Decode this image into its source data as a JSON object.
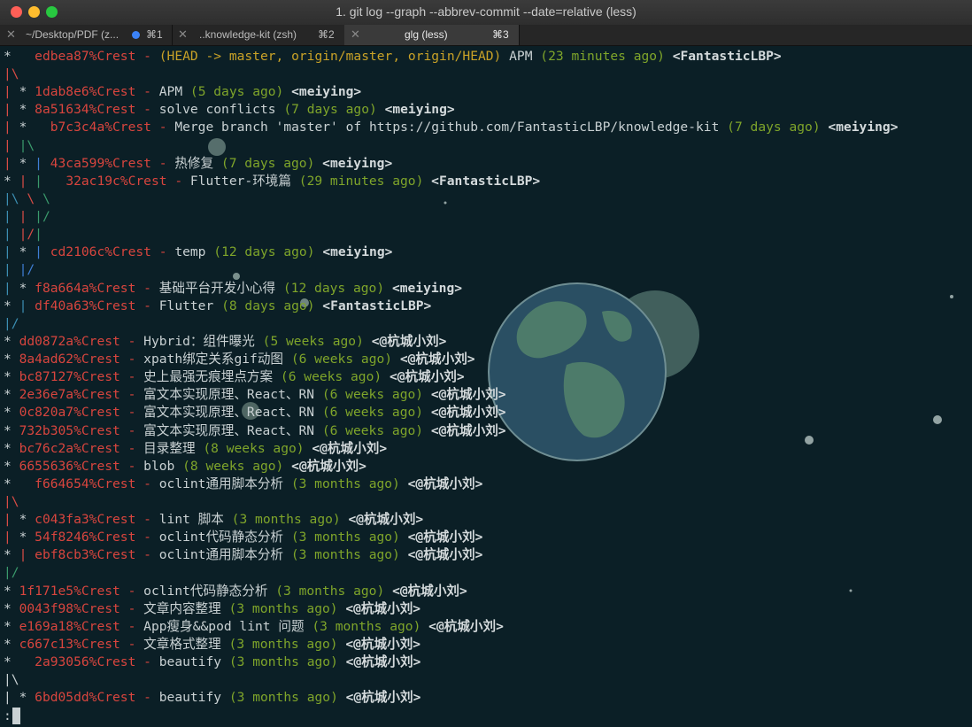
{
  "window": {
    "title": "1. git log --graph  --abbrev-commit --date=relative (less)"
  },
  "tabs": [
    {
      "label": "~/Desktop/PDF (z...",
      "shortcut": "⌘1"
    },
    {
      "label": "..knowledge-kit (zsh)",
      "shortcut": "⌘2"
    },
    {
      "label": "glg (less)",
      "shortcut": "⌘3"
    }
  ],
  "colors": {
    "background": "#0b1f26",
    "hash": "#d8453e",
    "date": "#7fa52a",
    "refs": "#c9a227",
    "graph_red": "#d94c45",
    "graph_green": "#3a9a6c",
    "graph_blue": "#3f7fd6",
    "planet_ocean": "#2a4f63",
    "planet_land": "#4d7b6a"
  },
  "log": [
    {
      "graph": [
        [
          "*   ",
          "white"
        ]
      ],
      "hash": "edbea87%Crest",
      "refs": "(HEAD -> master, origin/master, origin/HEAD)",
      "subject": "APM",
      "date": "(23 minutes ago)",
      "author": "<FantasticLBP>"
    },
    {
      "graph": [
        [
          "|\\",
          "red"
        ]
      ]
    },
    {
      "graph": [
        [
          "| ",
          "red"
        ],
        [
          "* ",
          "white"
        ]
      ],
      "hash": "1dab8e6%Crest",
      "subject": "APM",
      "date": "(5 days ago)",
      "author": "<meiying>"
    },
    {
      "graph": [
        [
          "| ",
          "red"
        ],
        [
          "* ",
          "white"
        ]
      ],
      "hash": "8a51634%Crest",
      "subject": "solve conflicts",
      "date": "(7 days ago)",
      "author": "<meiying>"
    },
    {
      "graph": [
        [
          "| ",
          "red"
        ],
        [
          "*   ",
          "white"
        ]
      ],
      "hash": "b7c3c4a%Crest",
      "subject": "Merge branch 'master' of https://github.com/FantasticLBP/knowledge-kit",
      "date": "(7 days ago)",
      "author": "<meiying>"
    },
    {
      "graph": [
        [
          "| ",
          "red"
        ],
        [
          "|\\",
          "green"
        ]
      ]
    },
    {
      "graph": [
        [
          "| ",
          "red"
        ],
        [
          "* ",
          "white"
        ],
        [
          "| ",
          "blue"
        ]
      ],
      "hash": "43ca599%Crest",
      "subject": "热修复",
      "date": "(7 days ago)",
      "author": "<meiying>"
    },
    {
      "graph": [
        [
          "* ",
          "white"
        ],
        [
          "| ",
          "red"
        ],
        [
          "|   ",
          "green"
        ]
      ],
      "hash": "32ac19c%Crest",
      "subject": "Flutter-环境篇",
      "date": "(29 minutes ago)",
      "author": "<FantasticLBP>"
    },
    {
      "graph": [
        [
          "|\\ ",
          "cyan"
        ],
        [
          "\\ ",
          "red"
        ],
        [
          "\\",
          "green"
        ]
      ]
    },
    {
      "graph": [
        [
          "| ",
          "cyan"
        ],
        [
          "| ",
          "red"
        ],
        [
          "|/",
          "green"
        ]
      ]
    },
    {
      "graph": [
        [
          "| ",
          "cyan"
        ],
        [
          "|/",
          "red"
        ],
        [
          "|",
          "green"
        ]
      ]
    },
    {
      "graph": [
        [
          "| ",
          "cyan"
        ],
        [
          "* ",
          "white"
        ],
        [
          "| ",
          "blue"
        ]
      ],
      "hash": "cd2106c%Crest",
      "subject": "temp",
      "date": "(12 days ago)",
      "author": "<meiying>"
    },
    {
      "graph": [
        [
          "| ",
          "cyan"
        ],
        [
          "|/",
          "blue"
        ]
      ]
    },
    {
      "graph": [
        [
          "| ",
          "cyan"
        ],
        [
          "* ",
          "white"
        ]
      ],
      "hash": "f8a664a%Crest",
      "subject": "基础平台开发小心得",
      "date": "(12 days ago)",
      "author": "<meiying>"
    },
    {
      "graph": [
        [
          "* ",
          "white"
        ],
        [
          "| ",
          "cyan"
        ]
      ],
      "hash": "df40a63%Crest",
      "subject": "Flutter",
      "date": "(8 days ago)",
      "author": "<FantasticLBP>"
    },
    {
      "graph": [
        [
          "|/",
          "cyan"
        ]
      ]
    },
    {
      "graph": [
        [
          "* ",
          "white"
        ]
      ],
      "hash": "dd0872a%Crest",
      "subject": "Hybrid：组件曝光",
      "date": "(5 weeks ago)",
      "author": "<@杭城小刘>"
    },
    {
      "graph": [
        [
          "* ",
          "white"
        ]
      ],
      "hash": "8a4ad62%Crest",
      "subject": "xpath绑定关系gif动图",
      "date": "(6 weeks ago)",
      "author": "<@杭城小刘>"
    },
    {
      "graph": [
        [
          "* ",
          "white"
        ]
      ],
      "hash": "bc87127%Crest",
      "subject": "史上最强无痕埋点方案",
      "date": "(6 weeks ago)",
      "author": "<@杭城小刘>"
    },
    {
      "graph": [
        [
          "* ",
          "white"
        ]
      ],
      "hash": "2e36e7a%Crest",
      "subject": "富文本实现原理、React、RN",
      "date": "(6 weeks ago)",
      "author": "<@杭城小刘>"
    },
    {
      "graph": [
        [
          "* ",
          "white"
        ]
      ],
      "hash": "0c820a7%Crest",
      "subject": "富文本实现原理、React、RN",
      "date": "(6 weeks ago)",
      "author": "<@杭城小刘>"
    },
    {
      "graph": [
        [
          "* ",
          "white"
        ]
      ],
      "hash": "732b305%Crest",
      "subject": "富文本实现原理、React、RN",
      "date": "(6 weeks ago)",
      "author": "<@杭城小刘>"
    },
    {
      "graph": [
        [
          "* ",
          "white"
        ]
      ],
      "hash": "bc76c2a%Crest",
      "subject": "目录整理",
      "date": "(8 weeks ago)",
      "author": "<@杭城小刘>"
    },
    {
      "graph": [
        [
          "* ",
          "white"
        ]
      ],
      "hash": "6655636%Crest",
      "subject": "blob",
      "date": "(8 weeks ago)",
      "author": "<@杭城小刘>"
    },
    {
      "graph": [
        [
          "*   ",
          "white"
        ]
      ],
      "hash": "f664654%Crest",
      "subject": "oclint通用脚本分析",
      "date": "(3 months ago)",
      "author": "<@杭城小刘>"
    },
    {
      "graph": [
        [
          "|\\",
          "red"
        ]
      ]
    },
    {
      "graph": [
        [
          "| ",
          "red"
        ],
        [
          "* ",
          "white"
        ]
      ],
      "hash": "c043fa3%Crest",
      "subject": "lint 脚本",
      "date": "(3 months ago)",
      "author": "<@杭城小刘>"
    },
    {
      "graph": [
        [
          "| ",
          "red"
        ],
        [
          "* ",
          "white"
        ]
      ],
      "hash": "54f8246%Crest",
      "subject": "oclint代码静态分析",
      "date": "(3 months ago)",
      "author": "<@杭城小刘>"
    },
    {
      "graph": [
        [
          "* ",
          "white"
        ],
        [
          "| ",
          "red"
        ]
      ],
      "hash": "ebf8cb3%Crest",
      "subject": "oclint通用脚本分析",
      "date": "(3 months ago)",
      "author": "<@杭城小刘>"
    },
    {
      "graph": [
        [
          "|/",
          "green"
        ]
      ]
    },
    {
      "graph": [
        [
          "* ",
          "white"
        ]
      ],
      "hash": "1f171e5%Crest",
      "subject": "oclint代码静态分析",
      "date": "(3 months ago)",
      "author": "<@杭城小刘>"
    },
    {
      "graph": [
        [
          "* ",
          "white"
        ]
      ],
      "hash": "0043f98%Crest",
      "subject": "文章内容整理",
      "date": "(3 months ago)",
      "author": "<@杭城小刘>"
    },
    {
      "graph": [
        [
          "* ",
          "white"
        ]
      ],
      "hash": "e169a18%Crest",
      "subject": "App瘦身&&pod lint 问题",
      "date": "(3 months ago)",
      "author": "<@杭城小刘>"
    },
    {
      "graph": [
        [
          "* ",
          "white"
        ]
      ],
      "hash": "c667c13%Crest",
      "subject": "文章格式整理",
      "date": "(3 months ago)",
      "author": "<@杭城小刘>"
    },
    {
      "graph": [
        [
          "*   ",
          "white"
        ]
      ],
      "hash": "2a93056%Crest",
      "subject": "beautify",
      "date": "(3 months ago)",
      "author": "<@杭城小刘>"
    },
    {
      "graph": [
        [
          "|\\",
          "white"
        ]
      ]
    },
    {
      "graph": [
        [
          "| ",
          "white"
        ],
        [
          "* ",
          "white"
        ]
      ],
      "hash": "6bd05dd%Crest",
      "subject": "beautify",
      "date": "(3 months ago)",
      "author": "<@杭城小刘>"
    }
  ],
  "prompt": ":"
}
